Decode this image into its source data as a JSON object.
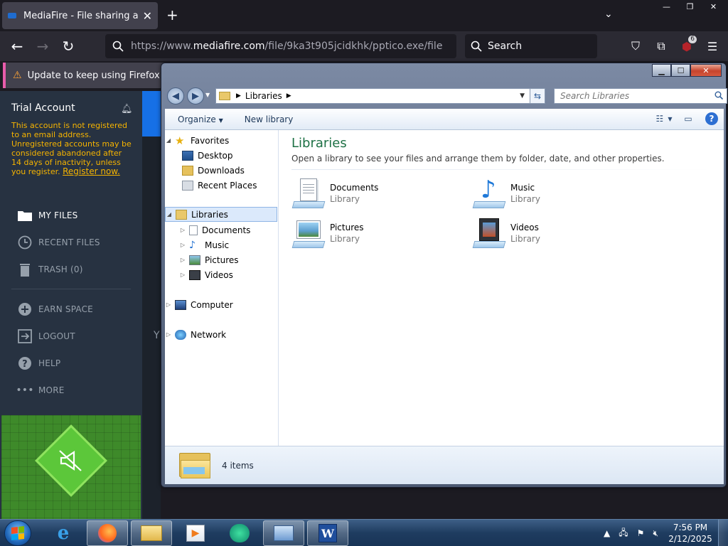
{
  "browser": {
    "tab_title": "MediaFire - File sharing and sto",
    "url_prefix": "https://www.",
    "url_host": "mediafire.com",
    "url_path": "/file/9ka3t905jcidkhk/pptico.exe/file",
    "search_placeholder": "Search",
    "extension_badge": "6",
    "notification": "Update to keep using Firefox after"
  },
  "mediafire": {
    "account_title": "Trial Account",
    "warning_text": "This account is not registered to an email address. Unregistered accounts may be considered abandoned after 14 days of inactivity, unless you register.",
    "register_link": "Register now.",
    "nav": {
      "my_files": "MY FILES",
      "recent_files": "RECENT FILES",
      "trash": "TRASH (0)",
      "earn_space": "EARN SPACE",
      "logout": "LOGOUT",
      "help": "HELP",
      "more": "MORE"
    },
    "partial_text": "Y"
  },
  "explorer": {
    "breadcrumb": "Libraries",
    "search_placeholder": "Search Libraries",
    "toolbar": {
      "organize": "Organize",
      "new_library": "New library"
    },
    "nav_tree": {
      "favorites": "Favorites",
      "desktop": "Desktop",
      "downloads": "Downloads",
      "recent_places": "Recent Places",
      "libraries": "Libraries",
      "documents": "Documents",
      "music": "Music",
      "pictures": "Pictures",
      "videos": "Videos",
      "computer": "Computer",
      "network": "Network"
    },
    "heading": "Libraries",
    "subheading": "Open a library to see your files and arrange them by folder, date, and other properties.",
    "libraries": [
      {
        "name": "Documents",
        "type": "Library"
      },
      {
        "name": "Music",
        "type": "Library"
      },
      {
        "name": "Pictures",
        "type": "Library"
      },
      {
        "name": "Videos",
        "type": "Library"
      }
    ],
    "status": "4 items"
  },
  "taskbar": {
    "time": "7:56 PM",
    "date": "2/12/2025"
  }
}
